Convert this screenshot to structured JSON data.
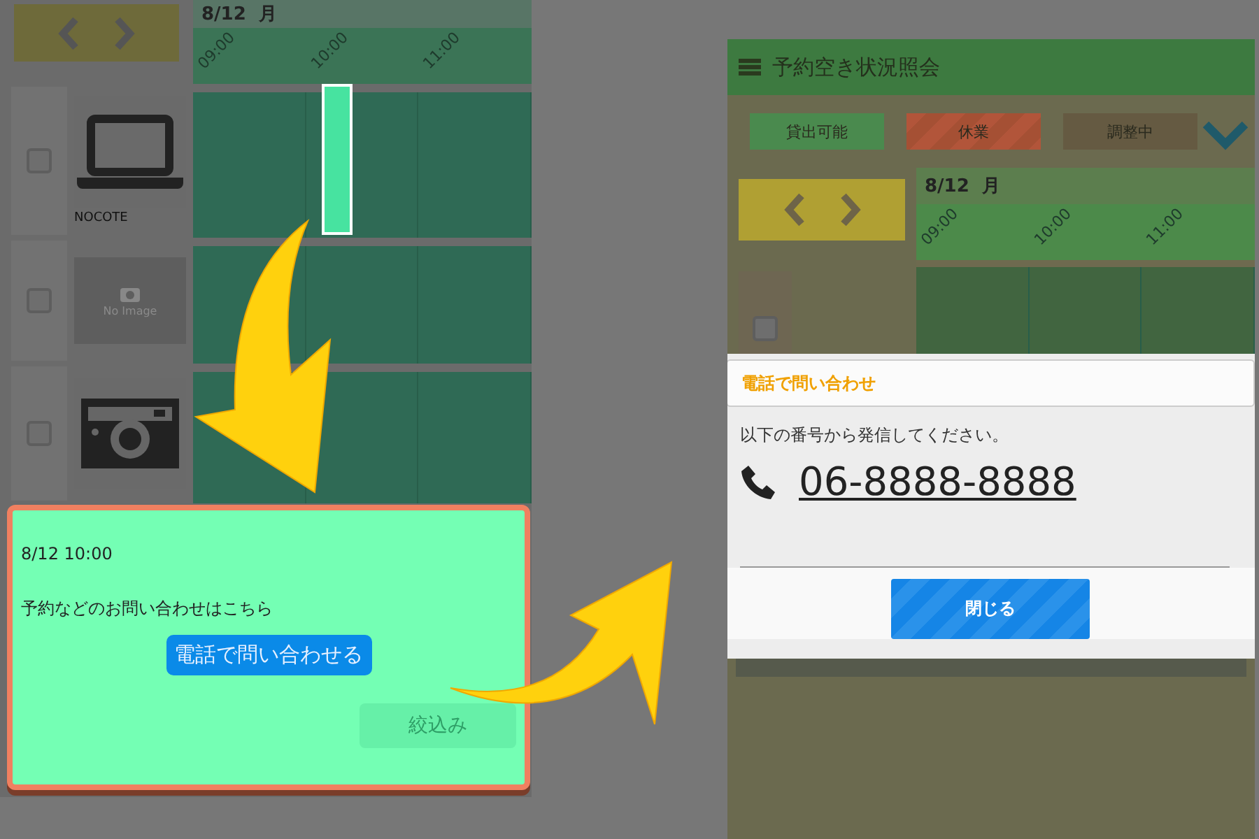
{
  "left_screen": {
    "date": "8/12",
    "weekday": "月",
    "times": [
      "09:00",
      "10:00",
      "11:00"
    ],
    "items": [
      {
        "checked": false,
        "kind": "laptop",
        "label": "NOCOTE",
        "booked": true
      },
      {
        "checked": false,
        "kind": "no_image",
        "image_text": "No Image",
        "booked": false
      },
      {
        "checked": false,
        "kind": "camera",
        "booked": false
      }
    ],
    "popup": {
      "datetime": "8/12 10:00",
      "message": "予約などのお問い合わせはこちら",
      "call_button": "電話で問い合わせる",
      "filter_button": {
        "label": "絞込み",
        "disabled": true
      }
    }
  },
  "right_screen": {
    "title": "予約空き状況照会",
    "legend": [
      {
        "label": "貸出可能",
        "kind": "available"
      },
      {
        "label": "休業",
        "kind": "closed"
      },
      {
        "label": "調整中",
        "kind": "adjusting"
      }
    ],
    "date": "8/12",
    "weekday": "月",
    "times": [
      "09:00",
      "10:00",
      "11:00"
    ],
    "items": [
      {
        "checked": false
      }
    ],
    "dialog": {
      "title": "電話で問い合わせ",
      "message": "以下の番号から発信してください。",
      "phone": "06-8888-8888",
      "close_button": "閉じる"
    }
  }
}
